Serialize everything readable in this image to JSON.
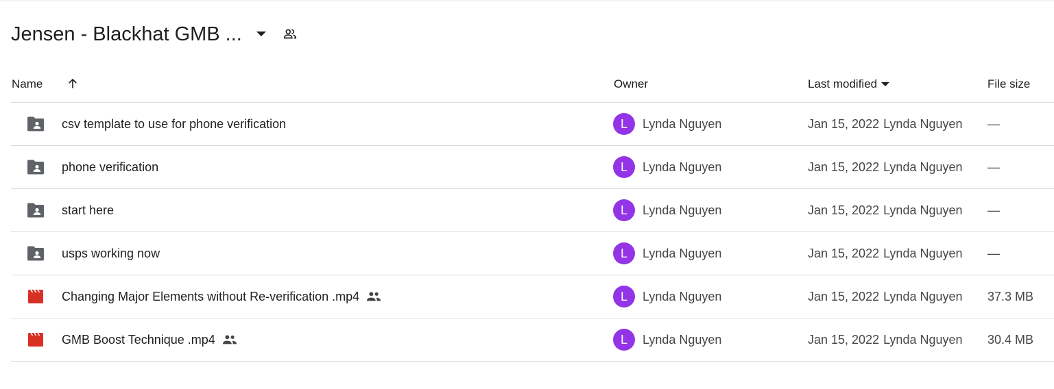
{
  "header": {
    "title": "Jensen - Blackhat GMB ...",
    "caret_icon": "arrow-drop-down-icon",
    "shared_icon": "people-outline-icon"
  },
  "columns": {
    "name": "Name",
    "sort_icon": "arrow-upward-icon",
    "owner": "Owner",
    "last_modified": "Last modified",
    "last_modified_icon": "arrow-drop-down-icon",
    "file_size": "File size"
  },
  "colors": {
    "avatar": "#9334e6",
    "folder_icon": "#5f6368",
    "video_icon": "#d93025",
    "divider": "#dadce0"
  },
  "rows": [
    {
      "type": "shared-folder",
      "icon": "shared-folder-icon",
      "name": "csv template to use for phone verification",
      "shared": false,
      "owner_initial": "L",
      "owner": "Lynda Nguyen",
      "modified_date": "Jan 15, 2022",
      "modified_by": "Lynda Nguyen",
      "size": "—"
    },
    {
      "type": "shared-folder",
      "icon": "shared-folder-icon",
      "name": "phone verification",
      "shared": false,
      "owner_initial": "L",
      "owner": "Lynda Nguyen",
      "modified_date": "Jan 15, 2022",
      "modified_by": "Lynda Nguyen",
      "size": "—"
    },
    {
      "type": "shared-folder",
      "icon": "shared-folder-icon",
      "name": "start here",
      "shared": false,
      "owner_initial": "L",
      "owner": "Lynda Nguyen",
      "modified_date": "Jan 15, 2022",
      "modified_by": "Lynda Nguyen",
      "size": "—"
    },
    {
      "type": "shared-folder",
      "icon": "shared-folder-icon",
      "name": "usps working now",
      "shared": false,
      "owner_initial": "L",
      "owner": "Lynda Nguyen",
      "modified_date": "Jan 15, 2022",
      "modified_by": "Lynda Nguyen",
      "size": "—"
    },
    {
      "type": "video",
      "icon": "video-file-icon",
      "name": "Changing Major Elements without Re-verification .mp4",
      "shared": true,
      "owner_initial": "L",
      "owner": "Lynda Nguyen",
      "modified_date": "Jan 15, 2022",
      "modified_by": "Lynda Nguyen",
      "size": "37.3 MB"
    },
    {
      "type": "video",
      "icon": "video-file-icon",
      "name": "GMB Boost Technique .mp4",
      "shared": true,
      "owner_initial": "L",
      "owner": "Lynda Nguyen",
      "modified_date": "Jan 15, 2022",
      "modified_by": "Lynda Nguyen",
      "size": "30.4 MB"
    }
  ]
}
